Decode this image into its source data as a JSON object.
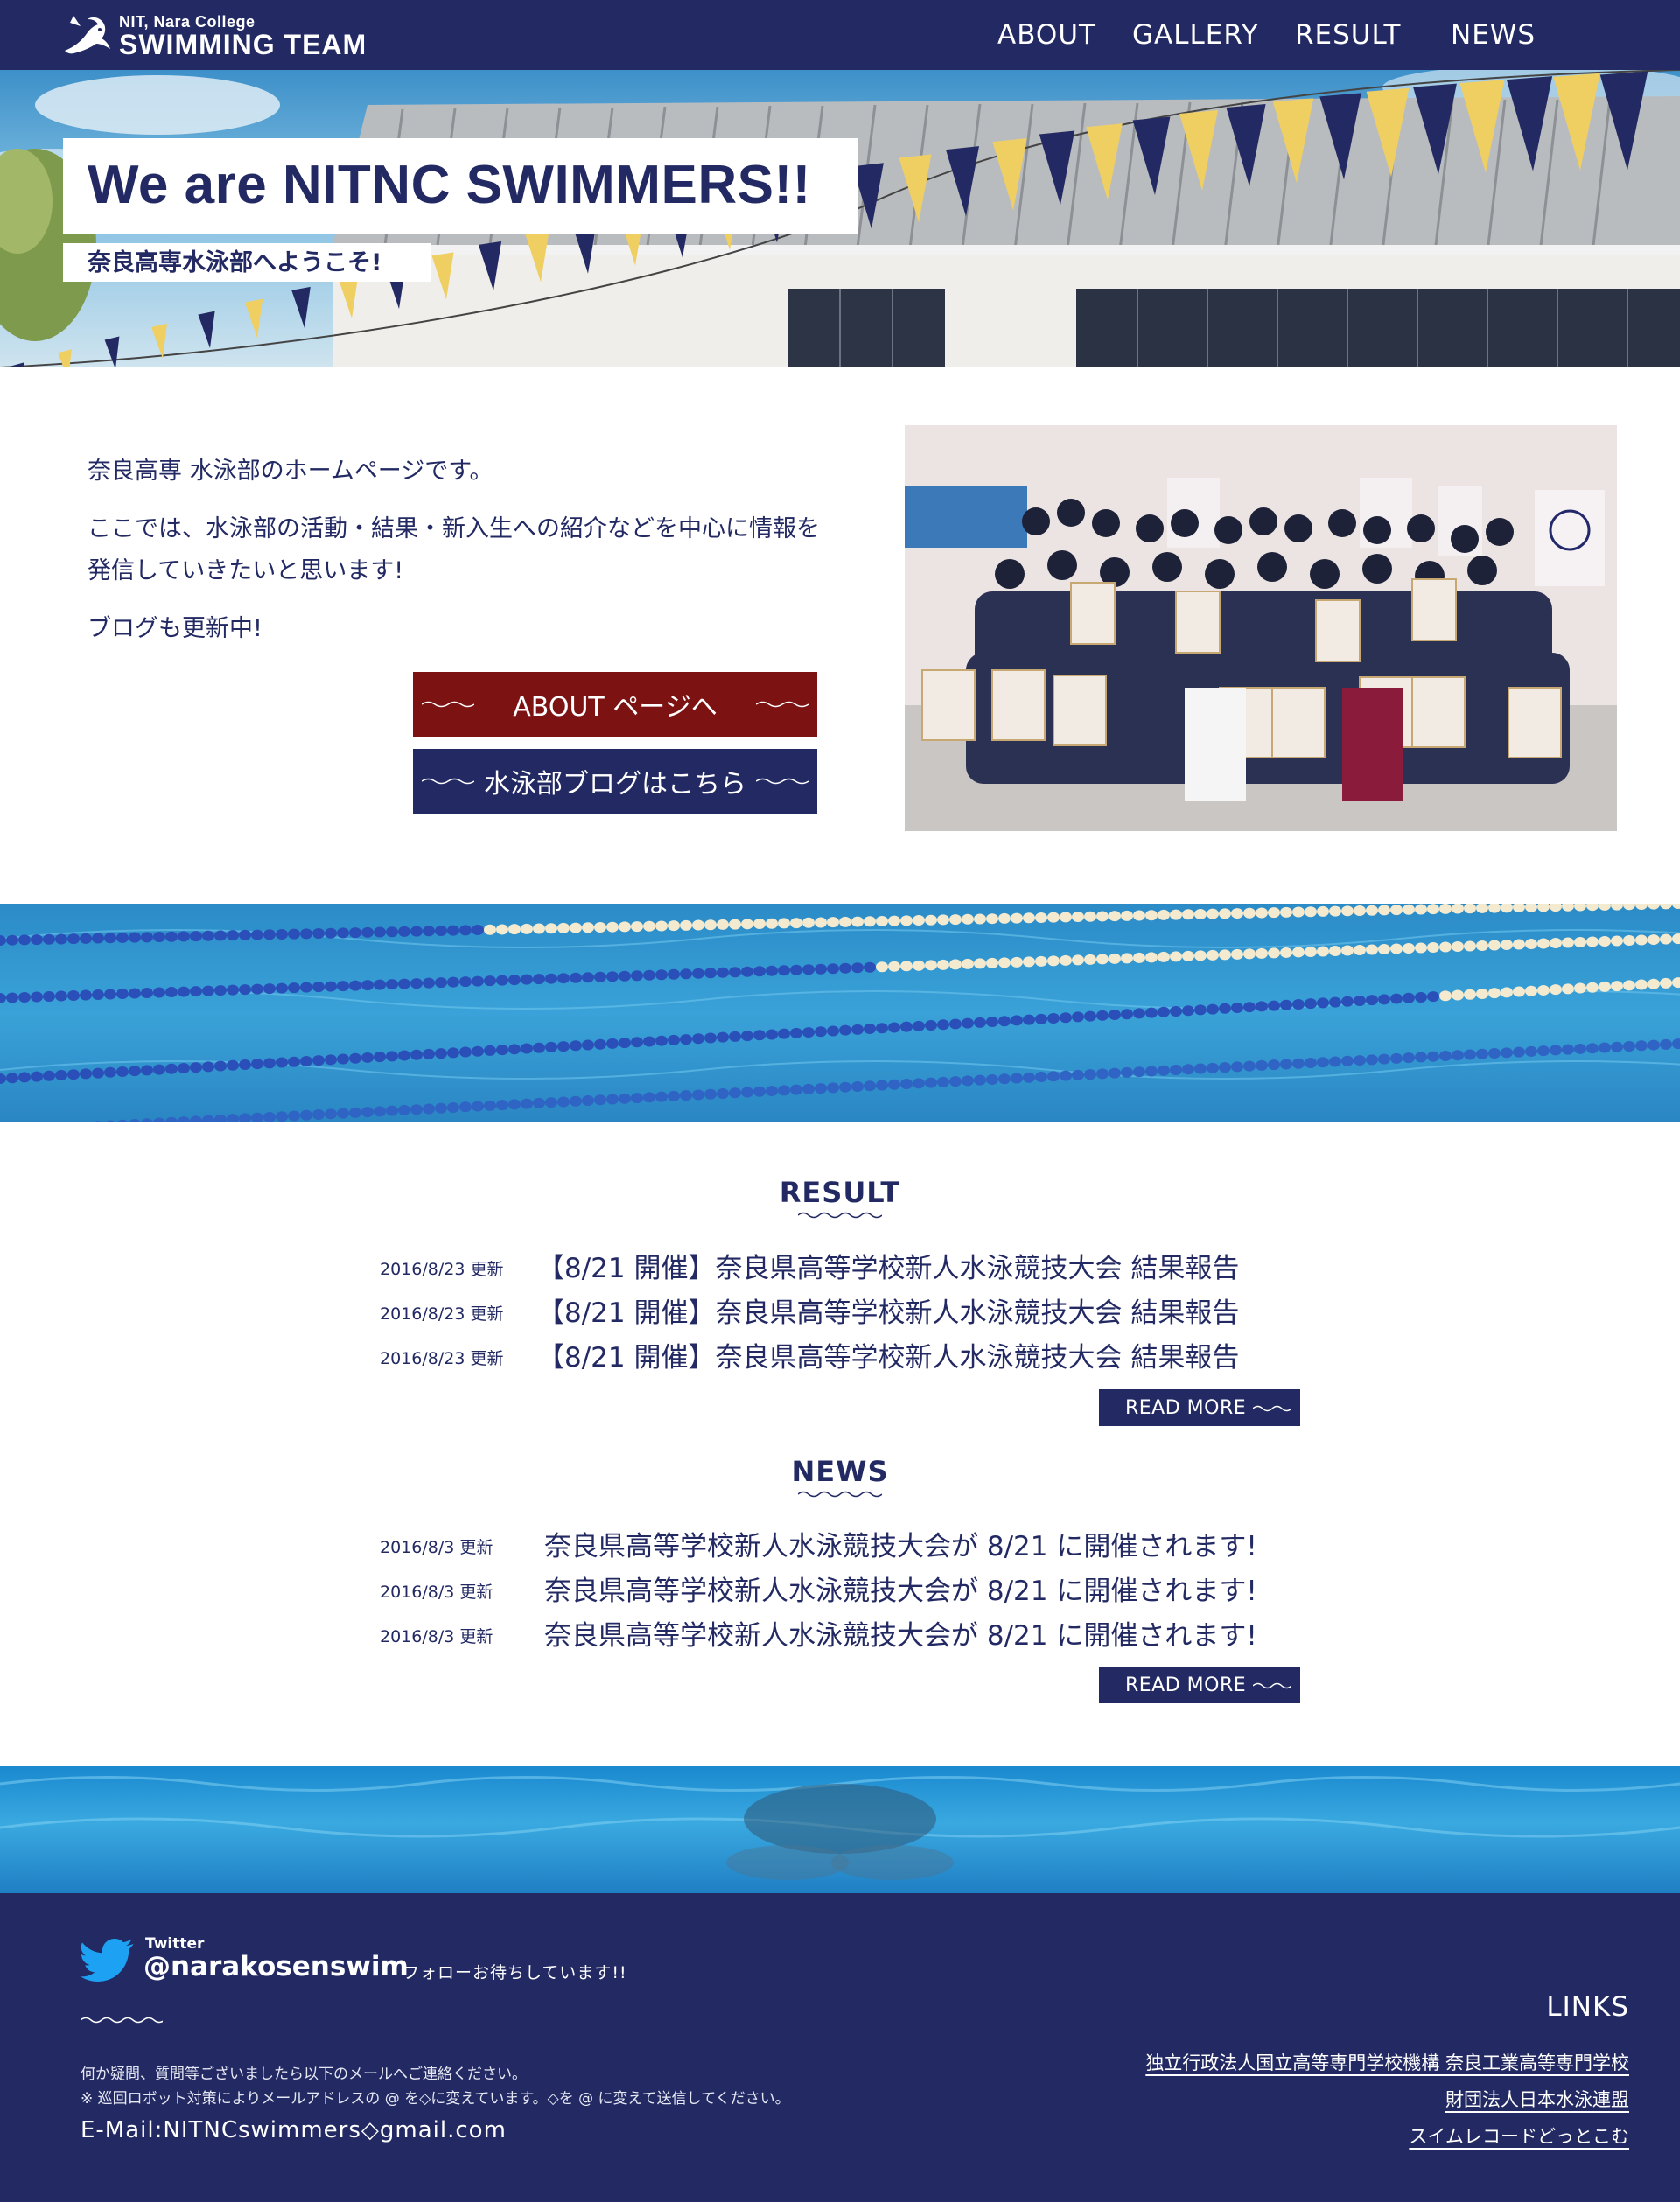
{
  "header": {
    "logo_line1": "NIT, Nara College",
    "logo_line2": "SWIMMING TEAM",
    "logo_icon": "swimmer-logo-icon",
    "nav": [
      "ABOUT",
      "GALLERY",
      "RESULT",
      "NEWS"
    ]
  },
  "hero": {
    "title": "We are NITNC SWIMMERS!!",
    "subtitle": "奈良高専水泳部へようこそ!"
  },
  "intro": {
    "p1": "奈良高専 水泳部のホームページです。",
    "p2": "ここでは、水泳部の活動・結果・新入生への紹介などを中心に情報を発信していきたいと思います!",
    "p3": "ブログも更新中!",
    "about_button": "ABOUT ページへ",
    "blog_button": "水泳部ブログはこちら"
  },
  "result": {
    "title": "RESULT",
    "items": [
      {
        "date": "2016/8/23 更新",
        "title": "【8/21 開催】奈良県高等学校新人水泳競技大会 結果報告"
      },
      {
        "date": "2016/8/23 更新",
        "title": "【8/21 開催】奈良県高等学校新人水泳競技大会 結果報告"
      },
      {
        "date": "2016/8/23 更新",
        "title": "【8/21 開催】奈良県高等学校新人水泳競技大会 結果報告"
      }
    ],
    "more": "READ MORE"
  },
  "news": {
    "title": "NEWS",
    "items": [
      {
        "date": "2016/8/3 更新",
        "title": "奈良県高等学校新人水泳競技大会が 8/21 に開催されます!"
      },
      {
        "date": "2016/8/3 更新",
        "title": "奈良県高等学校新人水泳競技大会が 8/21 に開催されます!"
      },
      {
        "date": "2016/8/3 更新",
        "title": "奈良県高等学校新人水泳競技大会が 8/21 に開催されます!"
      }
    ],
    "more": "READ MORE"
  },
  "footer": {
    "twitter_label": "Twitter",
    "twitter_handle": "@narakosenswim",
    "twitter_icon": "twitter-bird-icon",
    "follow": "フォローお待ちしています!!",
    "contact_line1": "何か疑問、質問等ございましたら以下のメールへご連絡ください。",
    "contact_line2": "※ 巡回ロボット対策によりメールアドレスの @ を◇に変えています。◇を @ に変えて送信してください。",
    "email": "E-Mail:NITNCswimmers◇gmail.com",
    "links_title": "LINKS",
    "links": [
      "独立行政法人国立高等専門学校機構 奈良工業高等専門学校",
      "財団法人日本水泳連盟",
      "スイムレコードどっとこむ"
    ]
  },
  "colors": {
    "navy": "#232a63",
    "maroon": "#7c1212",
    "pennant_yellow": "#f0cf62",
    "pennant_navy": "#232a63",
    "twitter_blue": "#1da1f2"
  }
}
